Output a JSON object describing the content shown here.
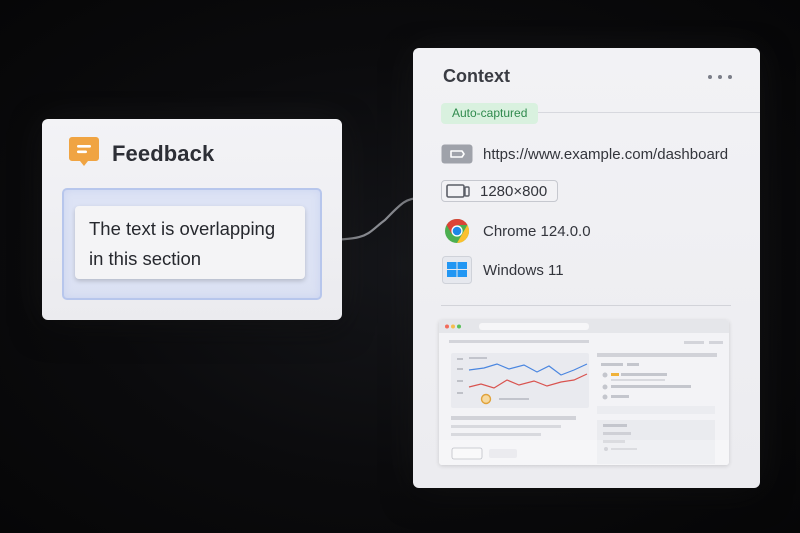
{
  "feedback": {
    "title": "Feedback",
    "icon": "chat-bubble-icon",
    "icon_color": "#f0a442",
    "message_line1": "The text is overlapping",
    "message_line2": "in this section"
  },
  "context": {
    "title": "Context",
    "badge": "Auto-captured",
    "badge_color": "#d9f1df",
    "items": [
      {
        "icon": "link-icon",
        "label": "https://www.example.com/dashboard"
      },
      {
        "icon": "monitor-icon",
        "label": "1280×800"
      },
      {
        "icon": "chrome-icon",
        "label": "Chrome 124.0.0"
      },
      {
        "icon": "windows-icon",
        "label": "Windows 11"
      }
    ]
  }
}
